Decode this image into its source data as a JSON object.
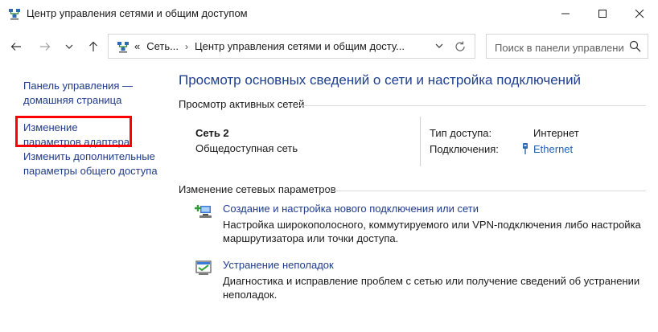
{
  "window": {
    "title": "Центр управления сетями и общим доступом"
  },
  "address": {
    "crumb_overflow": "«",
    "crumb1": "Сеть...",
    "crumb2": "Центр управления сетями и общим досту..."
  },
  "search": {
    "placeholder": "Поиск в панели управления"
  },
  "sidebar": {
    "items": [
      {
        "label": "Панель управления — домашняя страница"
      },
      {
        "label": "Изменение параметров адаптера"
      },
      {
        "label": "Изменить дополнительные параметры общего доступа"
      }
    ]
  },
  "main": {
    "title": "Просмотр основных сведений о сети и настройка подключений",
    "active_networks": {
      "heading": "Просмотр активных сетей",
      "network_name": "Сеть 2",
      "network_type": "Общедоступная сеть",
      "access_label": "Тип доступа:",
      "access_value": "Интернет",
      "connections_label": "Подключения:",
      "connections_value": "Ethernet"
    },
    "change_settings": {
      "heading": "Изменение сетевых параметров",
      "tasks": [
        {
          "label": "Создание и настройка нового подключения или сети",
          "description": "Настройка широкополосного, коммутируемого или VPN-подключения либо настройка маршрутизатора или точки доступа."
        },
        {
          "label": "Устранение неполадок",
          "description": "Диагностика и исправление проблем с сетью или получение сведений об устранении неполадок."
        }
      ]
    }
  },
  "colors": {
    "link": "#1f3a8a",
    "title": "#1e3f8f",
    "highlight": "#ff0000"
  }
}
